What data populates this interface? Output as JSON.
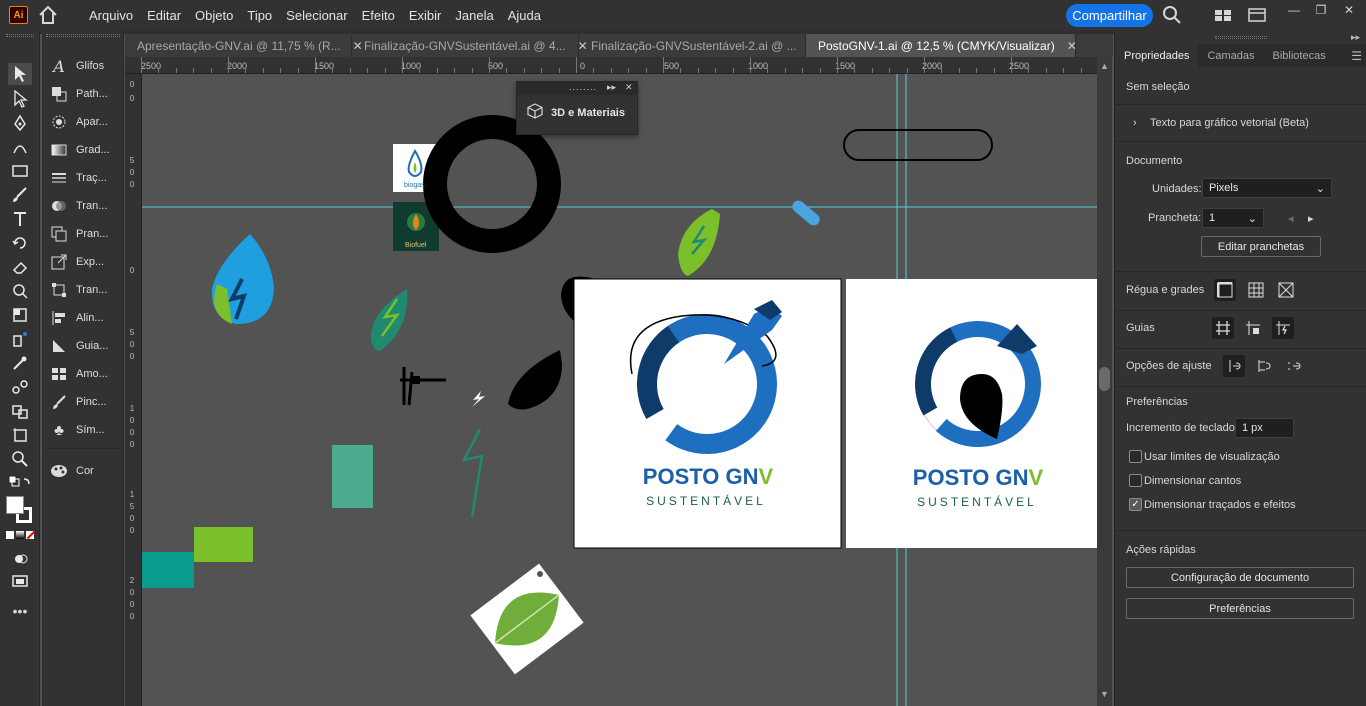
{
  "app": {
    "logo": "Ai",
    "share_label": "Compartilhar"
  },
  "menu": [
    "Arquivo",
    "Editar",
    "Objeto",
    "Tipo",
    "Selecionar",
    "Efeito",
    "Exibir",
    "Janela",
    "Ajuda"
  ],
  "tabs": [
    {
      "label": "Apresentação-GNV.ai @ 11,75 % (R..."
    },
    {
      "label": "Finalização-GNVSustentável.ai @ 4..."
    },
    {
      "label": "Finalização-GNVSustentável-2.ai @ ..."
    },
    {
      "label": "PostoGNV-1.ai @ 12,5 % (CMYK/Visualizar)"
    }
  ],
  "dock": [
    "Glifos",
    "Path...",
    "Apar...",
    "Grad...",
    "Traç...",
    "Tran...",
    "Pran...",
    "Exp...",
    "Tran...",
    "Alin...",
    "Guia...",
    "Amo...",
    "Pinc...",
    "Sím...",
    "Cor"
  ],
  "ruler_top": [
    "2500",
    "2000",
    "1500",
    "1000",
    "500",
    "0",
    "500",
    "1000",
    "1500",
    "2000",
    "2500"
  ],
  "ruler_left": [
    "0",
    "0",
    "5",
    "0",
    "0",
    "0",
    "5",
    "0",
    "0",
    "1",
    "0",
    "0",
    "0",
    "1",
    "5",
    "0",
    "0",
    "2",
    "0",
    "0",
    "0"
  ],
  "float_panel": {
    "label": "3D e Materiais"
  },
  "canvas": {
    "logo_title": "POSTO GN",
    "logo_title_v": "V",
    "logo_sub": "SUSTENTÁVEL",
    "biogas": "biogas",
    "biofuel": "Biofuel"
  },
  "props": {
    "tabs": [
      "Propriedades",
      "Camadas",
      "Bibliotecas"
    ],
    "no_selection": "Sem seleção",
    "vector_text": "Texto para gráfico vetorial (Beta)",
    "document": "Documento",
    "units_label": "Unidades:",
    "units_value": "Pixels",
    "artboard_label": "Prancheta:",
    "artboard_value": "1",
    "edit_artboards": "Editar pranchetas",
    "rulers_grids": "Régua e grades",
    "guides": "Guias",
    "snap_options": "Opções de ajuste",
    "preferences": "Preferências",
    "keyboard_increment_label": "Incremento de teclado:",
    "keyboard_increment_value": "1 px",
    "use_preview_bounds": "Usar limites de visualização",
    "scale_corners": "Dimensionar cantos",
    "scale_strokes": "Dimensionar traçados e efeitos",
    "quick_actions": "Ações rápidas",
    "doc_setup": "Configuração de documento",
    "prefs_button": "Preferências"
  },
  "colors": {
    "accent": "#1473e6",
    "logo_blue": "#1a5fa8",
    "logo_dark": "#0f3b6b",
    "logo_green": "#7bbf2a",
    "teal": "#1f8a70",
    "guide": "#4fd0d8"
  }
}
